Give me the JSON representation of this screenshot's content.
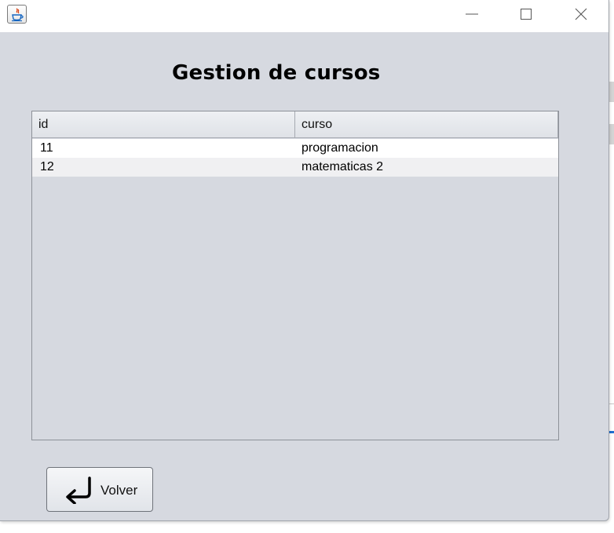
{
  "window": {
    "title": "",
    "controls": {
      "minimize_icon": "minimize-icon",
      "maximize_icon": "maximize-icon",
      "close_icon": "close-icon"
    }
  },
  "page": {
    "heading": "Gestion de cursos"
  },
  "table": {
    "columns": [
      "id",
      "curso"
    ],
    "rows": [
      {
        "id": "11",
        "curso": "programacion"
      },
      {
        "id": "12",
        "curso": "matematicas 2"
      }
    ]
  },
  "actions": {
    "back_label": "Volver",
    "back_icon": "return-arrow-icon"
  }
}
